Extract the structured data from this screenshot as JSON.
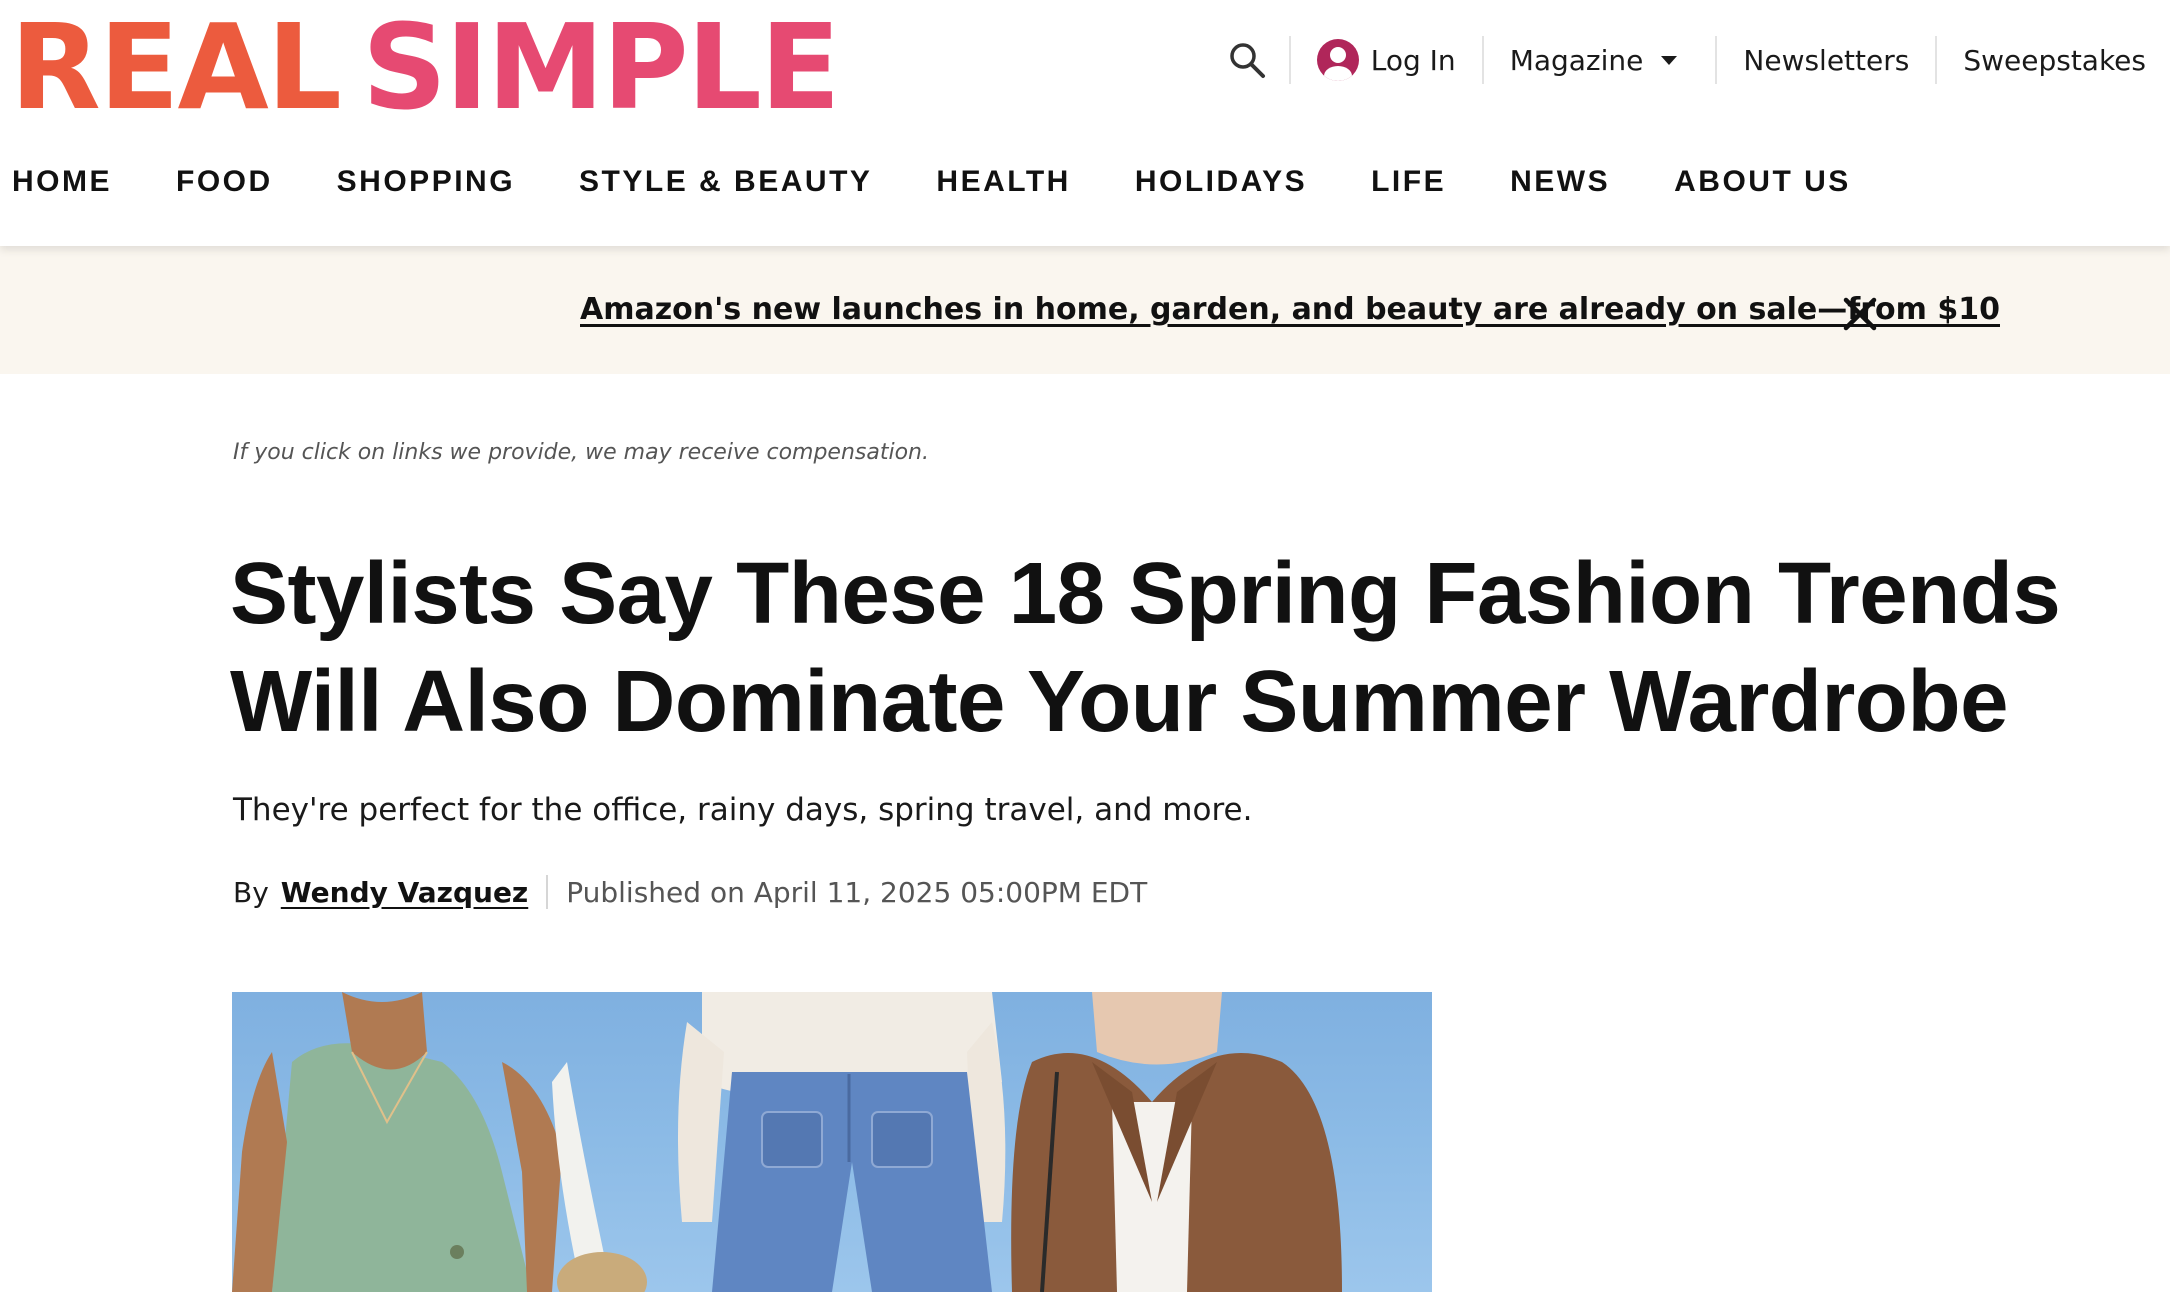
{
  "brand": {
    "logo_word_1": "REAL",
    "logo_word_2": "SIMPLE",
    "colors": {
      "real": "#ec5b3e",
      "simple": "#e64a72",
      "account": "#b0265a",
      "banner_bg": "#faf6ef"
    }
  },
  "utility_nav": {
    "search_icon": "search-icon",
    "login_label": "Log In",
    "magazine_label": "Magazine",
    "newsletters_label": "Newsletters",
    "sweepstakes_label": "Sweepstakes"
  },
  "main_nav": {
    "items": [
      "HOME",
      "FOOD",
      "SHOPPING",
      "STYLE & BEAUTY",
      "HEALTH",
      "HOLIDAYS",
      "LIFE",
      "NEWS",
      "ABOUT US"
    ]
  },
  "promo_banner": {
    "text": "Amazon's new launches in home, garden, and beauty are already on sale—from $10",
    "close_icon": "close-icon"
  },
  "article": {
    "disclaimer": "If you click on links we provide, we may receive compensation.",
    "headline": "Stylists Say These 18 Spring Fashion Trends Will Also Dominate Your Summer Wardrobe",
    "dek": "They're perfect for the office, rainy days, spring travel, and more.",
    "byline_prefix": "By",
    "author": "Wendy Vazquez",
    "published": "Published on April 11, 2025 05:00PM EDT"
  },
  "hero_image": {
    "subject": "three models in spring outfits: green vest, wide-leg jeans, brown blazer"
  }
}
